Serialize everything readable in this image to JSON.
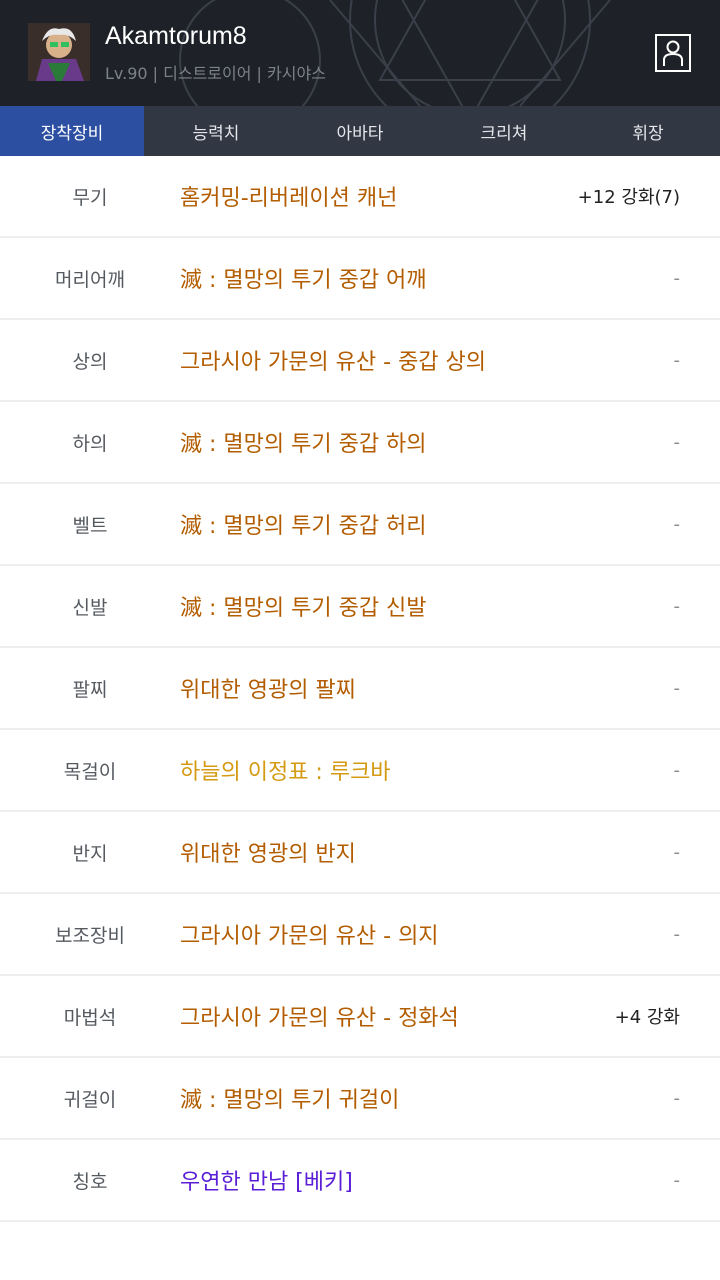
{
  "character": {
    "name": "Akamtorum8",
    "info": "Lv.90 | 디스트로이어 | 카시야스"
  },
  "tabs": [
    {
      "label": "장착장비",
      "active": true
    },
    {
      "label": "능력치",
      "active": false
    },
    {
      "label": "아바타",
      "active": false
    },
    {
      "label": "크리쳐",
      "active": false
    },
    {
      "label": "휘장",
      "active": false
    }
  ],
  "colors": {
    "header_bg": "#1e2127",
    "tab_bar": "#323744",
    "tab_active": "#2c4fa2",
    "rarity_epic": "#b35c00",
    "rarity_legendary": "#d49a12",
    "rarity_rare": "#5a1ed6"
  },
  "equipment": [
    {
      "slot": "무기",
      "item": "홈커밍-리버레이션 캐넌",
      "extra": "+12 강화(7)",
      "rarity": "epic"
    },
    {
      "slot": "머리어깨",
      "item": "滅 : 멸망의 투기 중갑 어깨",
      "extra": "-",
      "rarity": "epic"
    },
    {
      "slot": "상의",
      "item": "그라시아 가문의 유산 - 중갑 상의",
      "extra": "-",
      "rarity": "epic"
    },
    {
      "slot": "하의",
      "item": "滅 : 멸망의 투기 중갑 하의",
      "extra": "-",
      "rarity": "epic"
    },
    {
      "slot": "벨트",
      "item": "滅 : 멸망의 투기 중갑 허리",
      "extra": "-",
      "rarity": "epic"
    },
    {
      "slot": "신발",
      "item": "滅 : 멸망의 투기 중갑 신발",
      "extra": "-",
      "rarity": "epic"
    },
    {
      "slot": "팔찌",
      "item": "위대한 영광의 팔찌",
      "extra": "-",
      "rarity": "epic"
    },
    {
      "slot": "목걸이",
      "item": "하늘의 이정표 : 루크바",
      "extra": "-",
      "rarity": "legendary"
    },
    {
      "slot": "반지",
      "item": "위대한 영광의 반지",
      "extra": "-",
      "rarity": "epic"
    },
    {
      "slot": "보조장비",
      "item": "그라시아 가문의 유산 - 의지",
      "extra": "-",
      "rarity": "epic"
    },
    {
      "slot": "마법석",
      "item": "그라시아 가문의 유산 - 정화석",
      "extra": "+4 강화",
      "rarity": "epic"
    },
    {
      "slot": "귀걸이",
      "item": "滅 : 멸망의 투기 귀걸이",
      "extra": "-",
      "rarity": "epic"
    },
    {
      "slot": "칭호",
      "item": "우연한 만남 [베키]",
      "extra": "-",
      "rarity": "rare"
    }
  ]
}
